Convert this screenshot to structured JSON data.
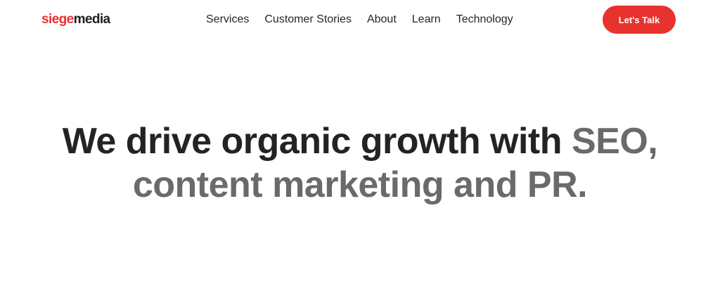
{
  "header": {
    "logo": {
      "part1": "siege",
      "part2": "media"
    },
    "nav": [
      "Services",
      "Customer Stories",
      "About",
      "Learn",
      "Technology"
    ],
    "cta_label": "Let's Talk"
  },
  "hero": {
    "line1_dark": "We drive organic growth with ",
    "line1_grey": "SEO,",
    "line2_grey": "content marketing and PR."
  },
  "colors": {
    "brand_red": "#e8322e",
    "text_dark": "#232323",
    "text_grey": "#6a6a6a"
  }
}
